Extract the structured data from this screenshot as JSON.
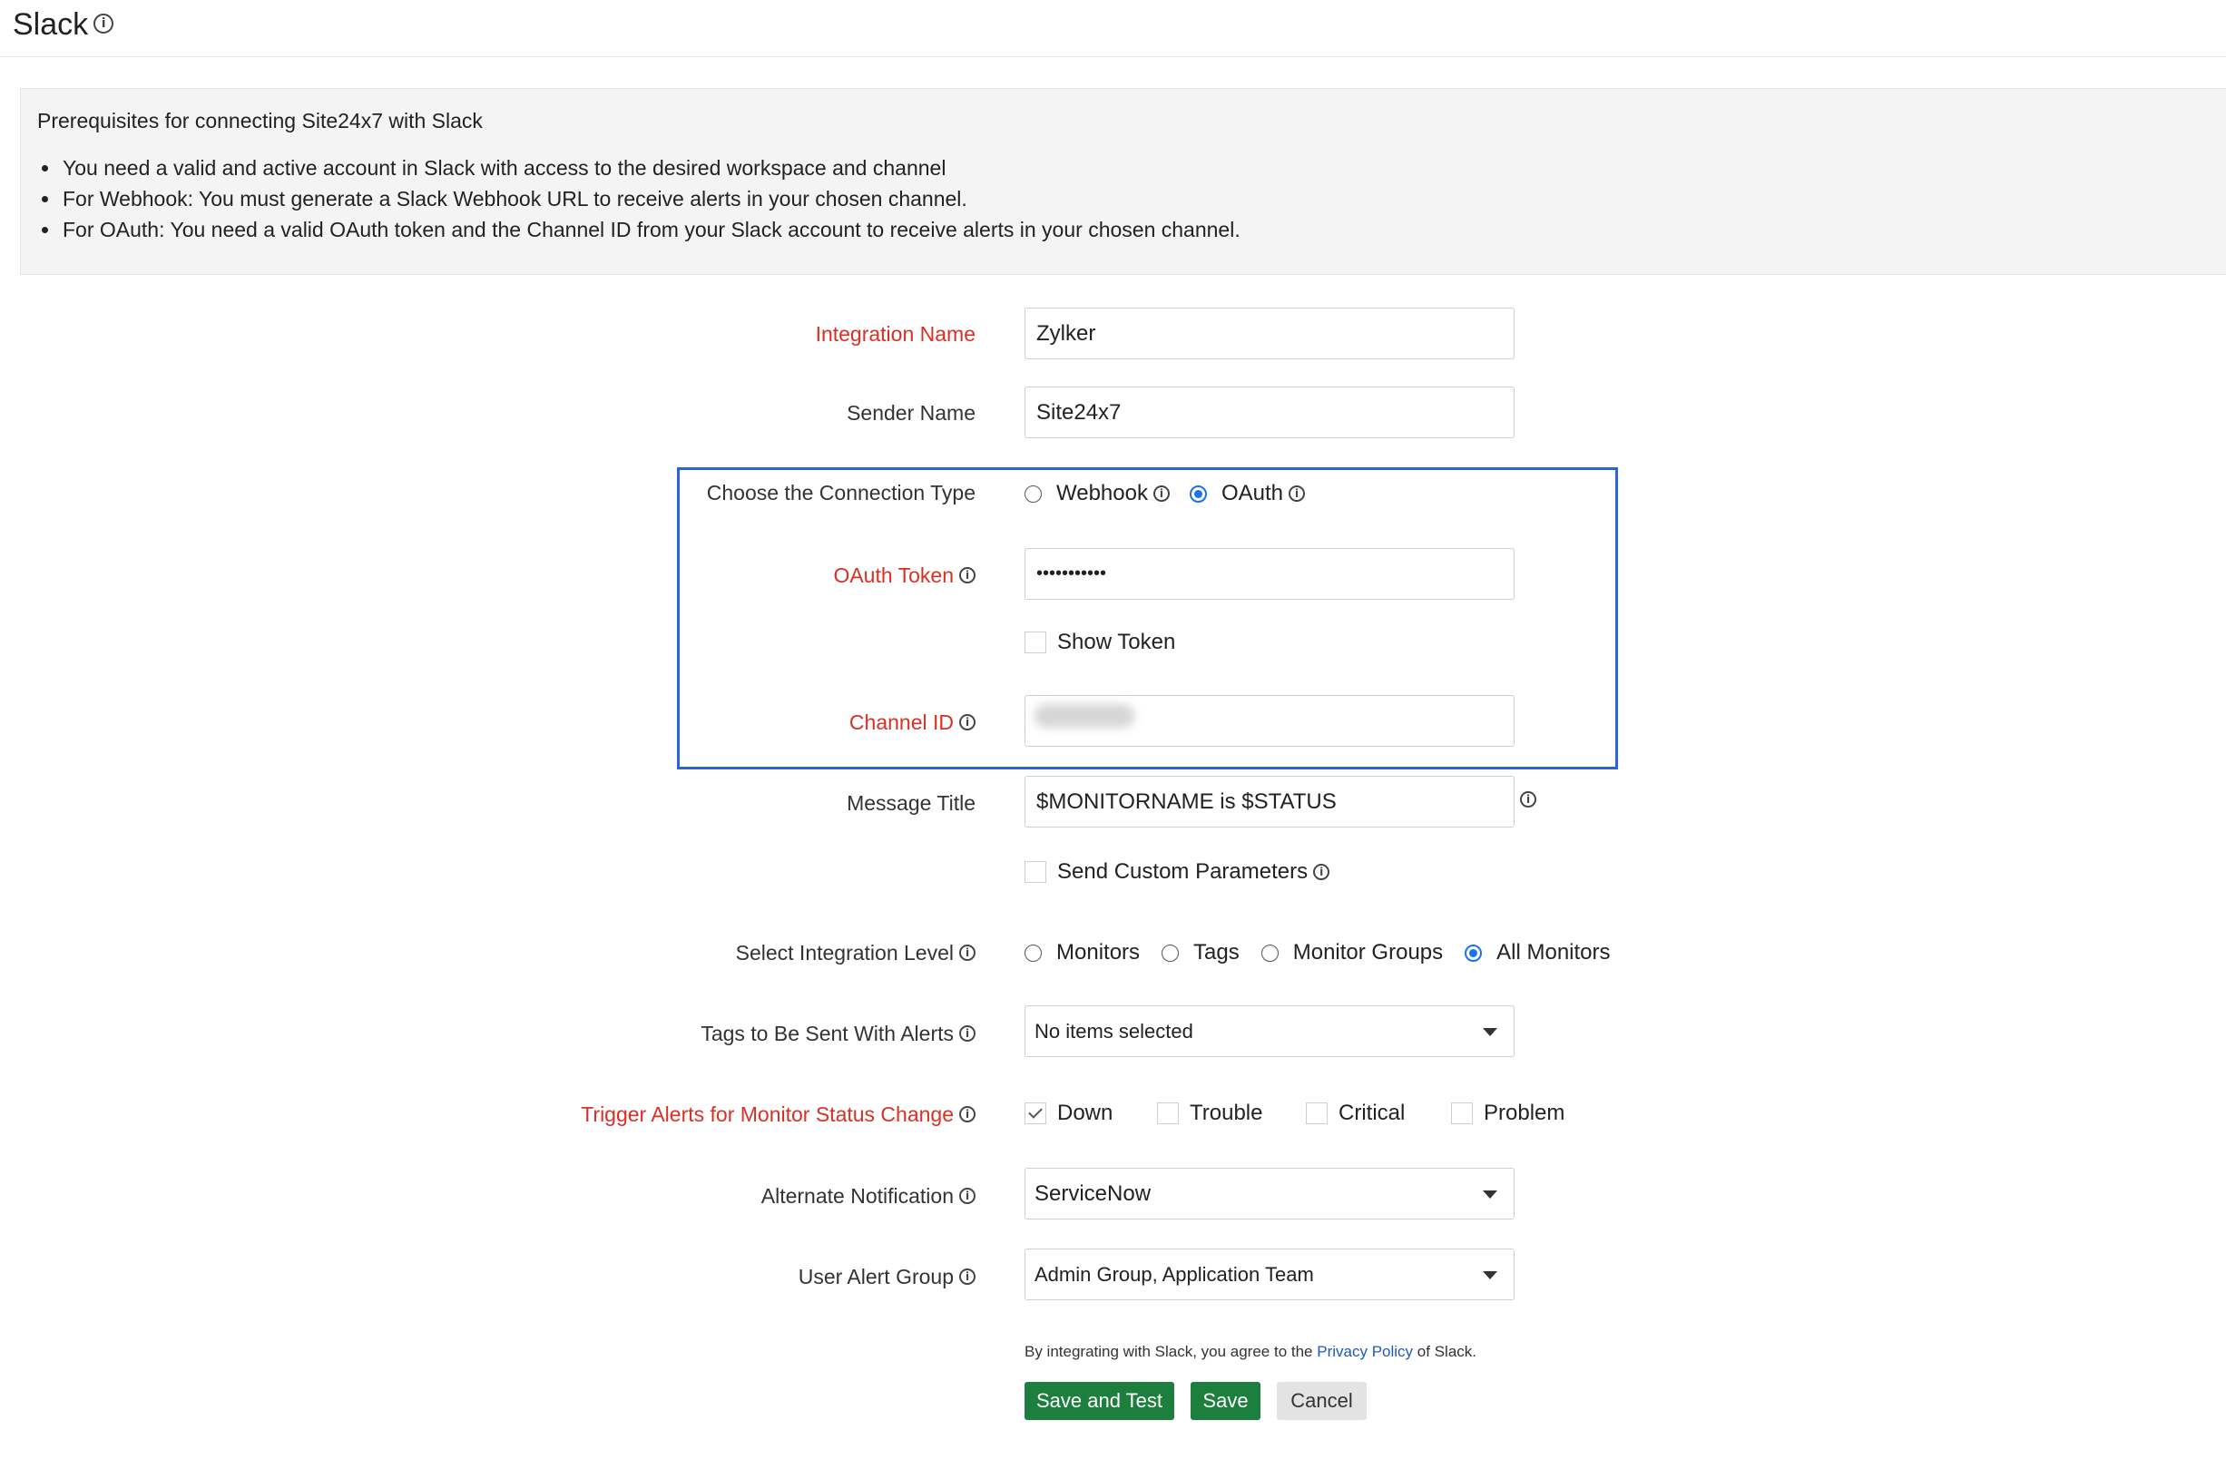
{
  "header": {
    "title": "Slack",
    "info_icon": "info-icon"
  },
  "prerequisites": {
    "title": "Prerequisites for connecting Site24x7 with Slack",
    "items": [
      "You need a valid and active account in Slack with access to the desired workspace and channel",
      "For Webhook: You must generate a Slack Webhook URL to receive alerts in your chosen channel.",
      "For OAuth: You need a valid OAuth token and the Channel ID from your Slack account to receive alerts in your chosen channel."
    ]
  },
  "form": {
    "integration_name": {
      "label": "Integration Name",
      "value": "Zylker",
      "required": true
    },
    "sender_name": {
      "label": "Sender Name",
      "value": "Site24x7"
    },
    "connection_type": {
      "label": "Choose the Connection Type",
      "options": [
        "Webhook",
        "OAuth"
      ],
      "selected": "OAuth"
    },
    "oauth_token": {
      "label": "OAuth Token",
      "value": "•••••••••••",
      "required": true
    },
    "show_token": {
      "label": "Show Token",
      "checked": false
    },
    "channel_id": {
      "label": "Channel ID",
      "value": "",
      "required": true
    },
    "message_title": {
      "label": "Message Title",
      "value": "$MONITORNAME is $STATUS"
    },
    "send_custom_parameters": {
      "label": "Send Custom Parameters",
      "checked": false
    },
    "integration_level": {
      "label": "Select Integration Level",
      "options": [
        "Monitors",
        "Tags",
        "Monitor Groups",
        "All Monitors"
      ],
      "selected": "All Monitors"
    },
    "tags": {
      "label": "Tags to Be Sent With Alerts",
      "value": "No items selected"
    },
    "trigger_alerts": {
      "label": "Trigger Alerts for Monitor Status Change",
      "required": true,
      "options": [
        "Down",
        "Trouble",
        "Critical",
        "Problem"
      ],
      "checked": [
        "Down"
      ]
    },
    "alternate_notification": {
      "label": "Alternate Notification",
      "value": "ServiceNow"
    },
    "user_alert_group": {
      "label": "User Alert Group",
      "value": "Admin Group, Application Team"
    }
  },
  "consent": {
    "prefix": "By integrating with Slack, you agree to the",
    "link": "Privacy Policy",
    "suffix": "of Slack."
  },
  "buttons": {
    "save_and_test": "Save and Test",
    "save": "Save",
    "cancel": "Cancel"
  },
  "colors": {
    "required_label": "#d93025",
    "highlight_border": "#2a64d8",
    "primary_button": "#1c7f3d",
    "radio_selected": "#1a73e8",
    "link": "#1f5ab6"
  }
}
